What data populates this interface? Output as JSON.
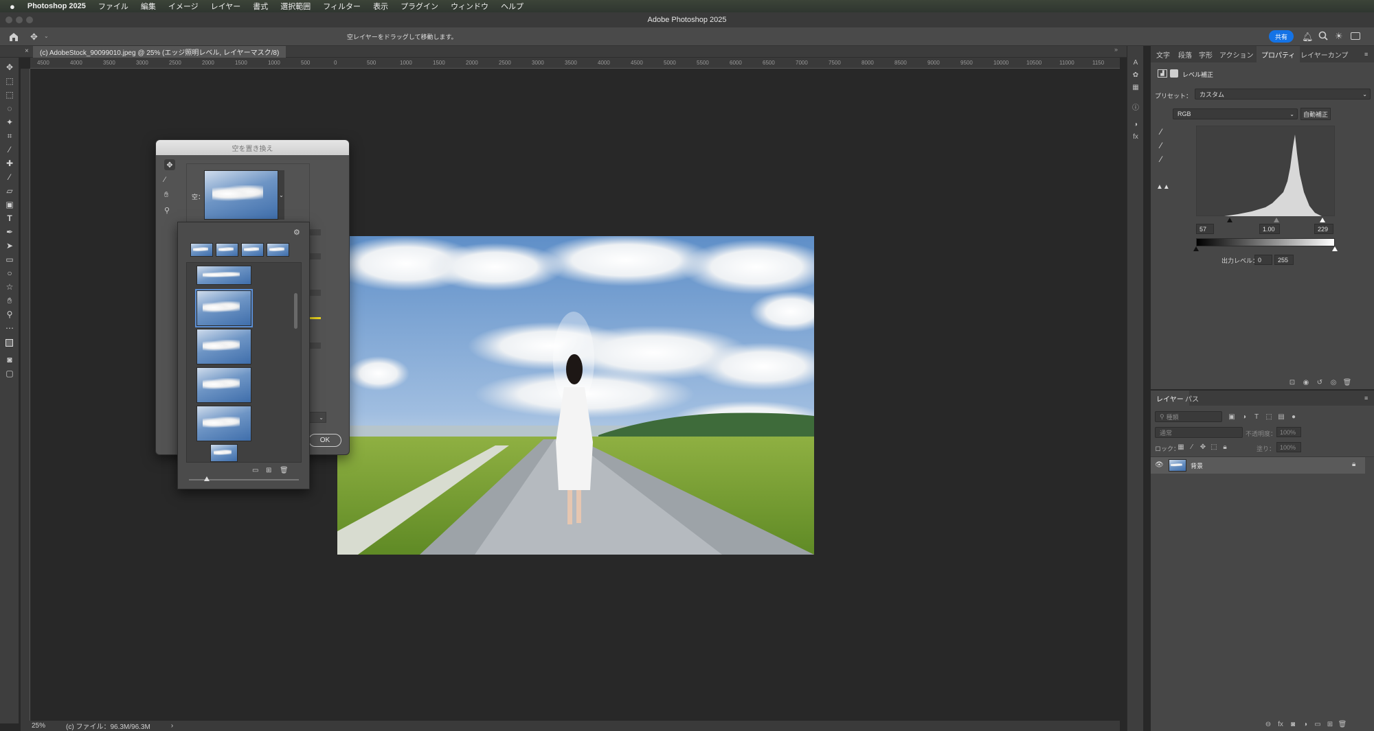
{
  "menu": {
    "apple": "",
    "app": "Photoshop 2025",
    "items": [
      "ファイル",
      "編集",
      "イメージ",
      "レイヤー",
      "書式",
      "選択範囲",
      "フィルター",
      "表示",
      "プラグイン",
      "ウィンドウ",
      "ヘルプ"
    ]
  },
  "window": {
    "title": "Adobe Photoshop 2025"
  },
  "options_bar": {
    "hint": "空レイヤーをドラッグして移動します。",
    "share_label": "共有"
  },
  "document": {
    "tab_title": "(c) AdobeStock_90099010.jpeg @ 25% (エッジ照明レベル, レイヤーマスク/8)",
    "close_glyph": "×"
  },
  "ruler": {
    "h_labels": [
      "4500",
      "4000",
      "3500",
      "3000",
      "2500",
      "2000",
      "1500",
      "1000",
      "500",
      "0",
      "500",
      "1000",
      "1500",
      "2000",
      "2500",
      "3000",
      "3500",
      "4000",
      "4500",
      "5000",
      "5500",
      "6000",
      "6500",
      "7000",
      "7500",
      "8000",
      "8500",
      "9000",
      "9500",
      "10000",
      "10500",
      "11000",
      "1150"
    ]
  },
  "status": {
    "zoom": "25%",
    "file_info": "(c) ファイル：96.3M/96.3M",
    "arrow": "›"
  },
  "dialog": {
    "title": "空を置き換え",
    "sky_label": "空：",
    "ok_label": "OK"
  },
  "properties": {
    "tabs": [
      "文字",
      "段落",
      "字形",
      "アクション",
      "プロパティ",
      "レイヤーカンプ"
    ],
    "active_tab": "プロパティ",
    "adjustment_name": "レベル補正",
    "preset_label": "プリセット：",
    "preset_value": "カスタム",
    "channel": "RGB",
    "auto_label": "自動補正",
    "input_black": "57",
    "input_gamma": "1.00",
    "input_white": "229",
    "output_label": "出力レベル：",
    "output_black": "0",
    "output_white": "255"
  },
  "layers_panel": {
    "tabs": [
      "レイヤー",
      "パス"
    ],
    "filter_placeholder": "種類",
    "blend_mode": "通常",
    "opacity_label": "不透明度：",
    "opacity_value": "100%",
    "lock_label": "ロック：",
    "fill_label": "塗り：",
    "fill_value": "100%",
    "layers": [
      {
        "name": "背景",
        "visible": true,
        "locked": true
      }
    ]
  },
  "colors": {
    "accent": "#1473e6",
    "panel": "#474747",
    "canvas": "#282828"
  }
}
